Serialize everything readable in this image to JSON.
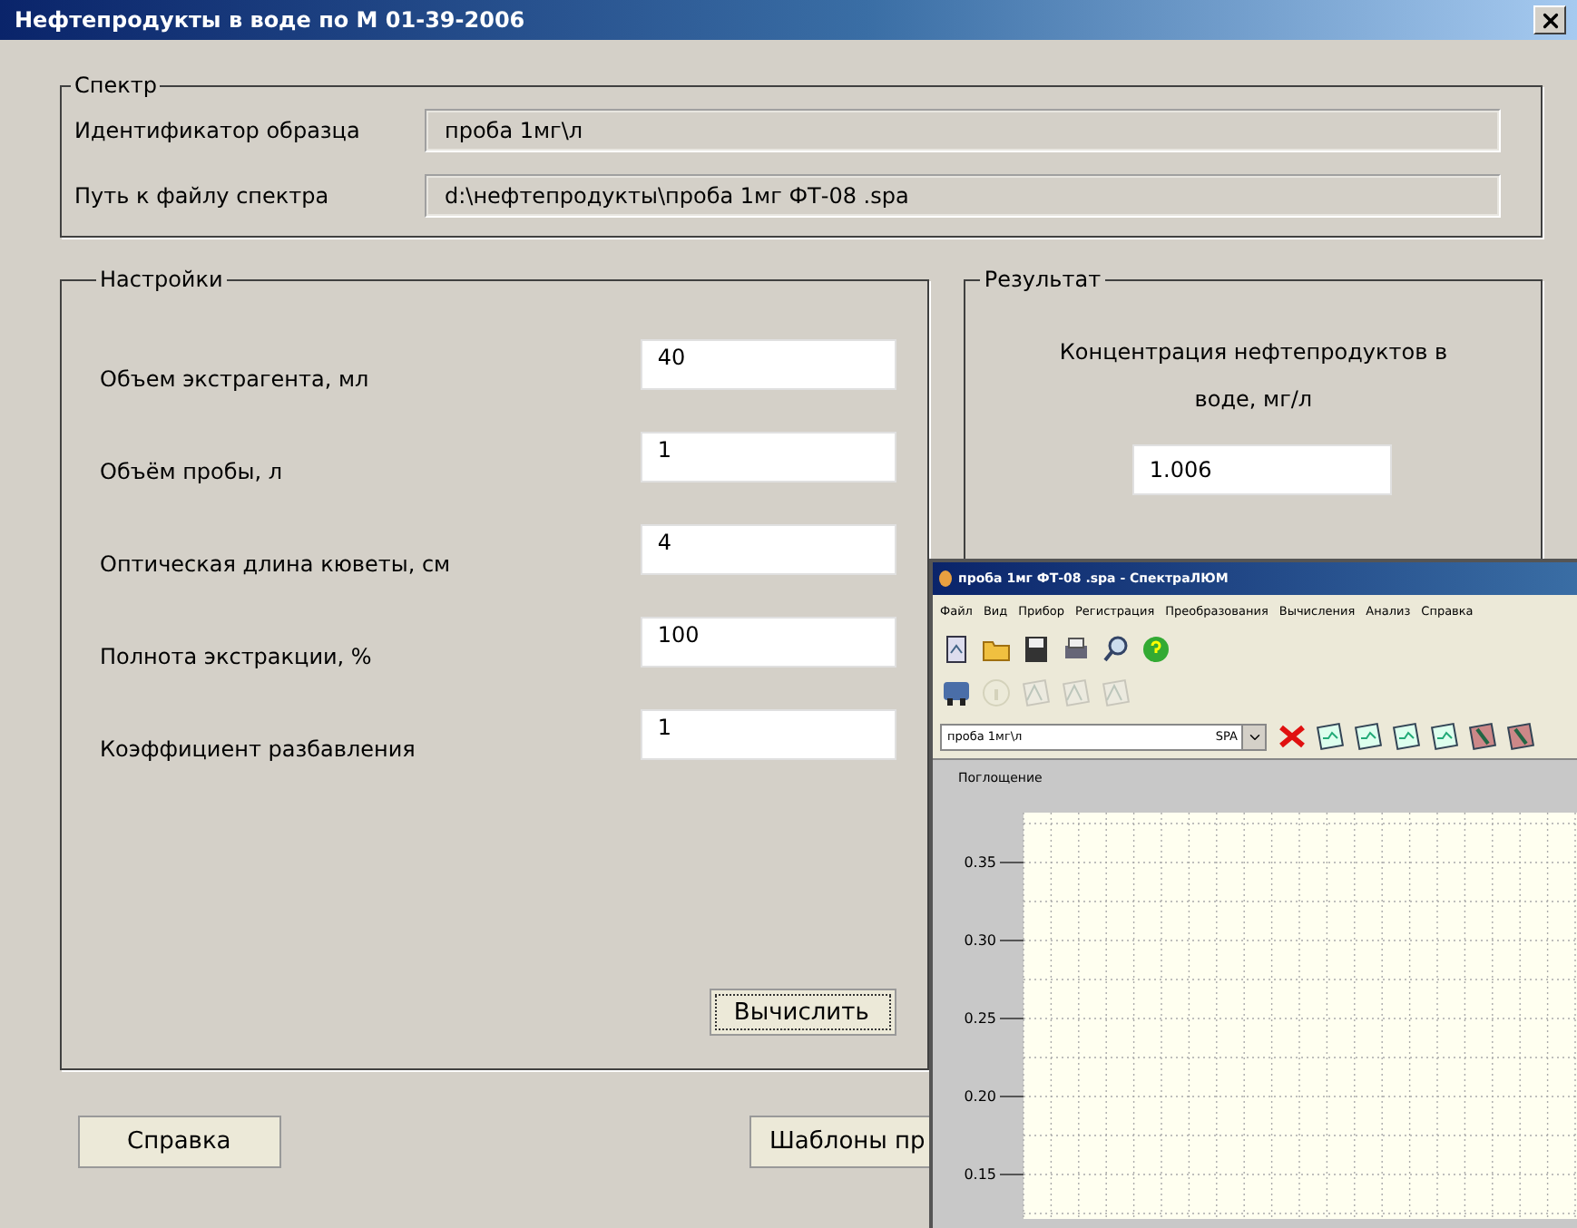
{
  "window": {
    "title": "Нефтепродукты в воде по М 01-39-2006"
  },
  "spectrum": {
    "legend": "Спектр",
    "fields": [
      {
        "label": "Идентификатор образца",
        "value": "проба 1мг\\л"
      },
      {
        "label": "Путь к файлу спектра",
        "value": "d:\\нефтепродукты\\проба 1мг ФТ-08 .spa"
      }
    ]
  },
  "settings": {
    "legend": "Настройки",
    "fields": [
      {
        "label": "Объем экстрагента, мл",
        "value": "40"
      },
      {
        "label": "Объём пробы, л",
        "value": "1"
      },
      {
        "label": "Оптическая длина кюветы, см",
        "value": "4"
      },
      {
        "label": "Полнота экстракции, %",
        "value": "100"
      },
      {
        "label": "Коэффициент разбавления",
        "value": "1"
      }
    ],
    "compute_button": "Вычислить"
  },
  "result": {
    "legend": "Результат",
    "label": "Концентрация нефтепродуктов в воде, мг/л",
    "value": "1.006"
  },
  "buttons": [
    "Справка",
    "Шаблоны пр"
  ],
  "spectra_window": {
    "title": "проба 1мг ФТ-08 .spa - СпектраЛЮМ",
    "menu": [
      "Файл",
      "Вид",
      "Прибор",
      "Регистрация",
      "Преобразования",
      "Вычисления",
      "Анализ",
      "Справка"
    ],
    "sample_combo": "проба 1мг\\л",
    "format_combo": "SPA",
    "chart": {
      "ylabel": "Поглощение",
      "yticks": [
        "0.35",
        "0.30",
        "0.25",
        "0.20",
        "0.15"
      ]
    }
  }
}
